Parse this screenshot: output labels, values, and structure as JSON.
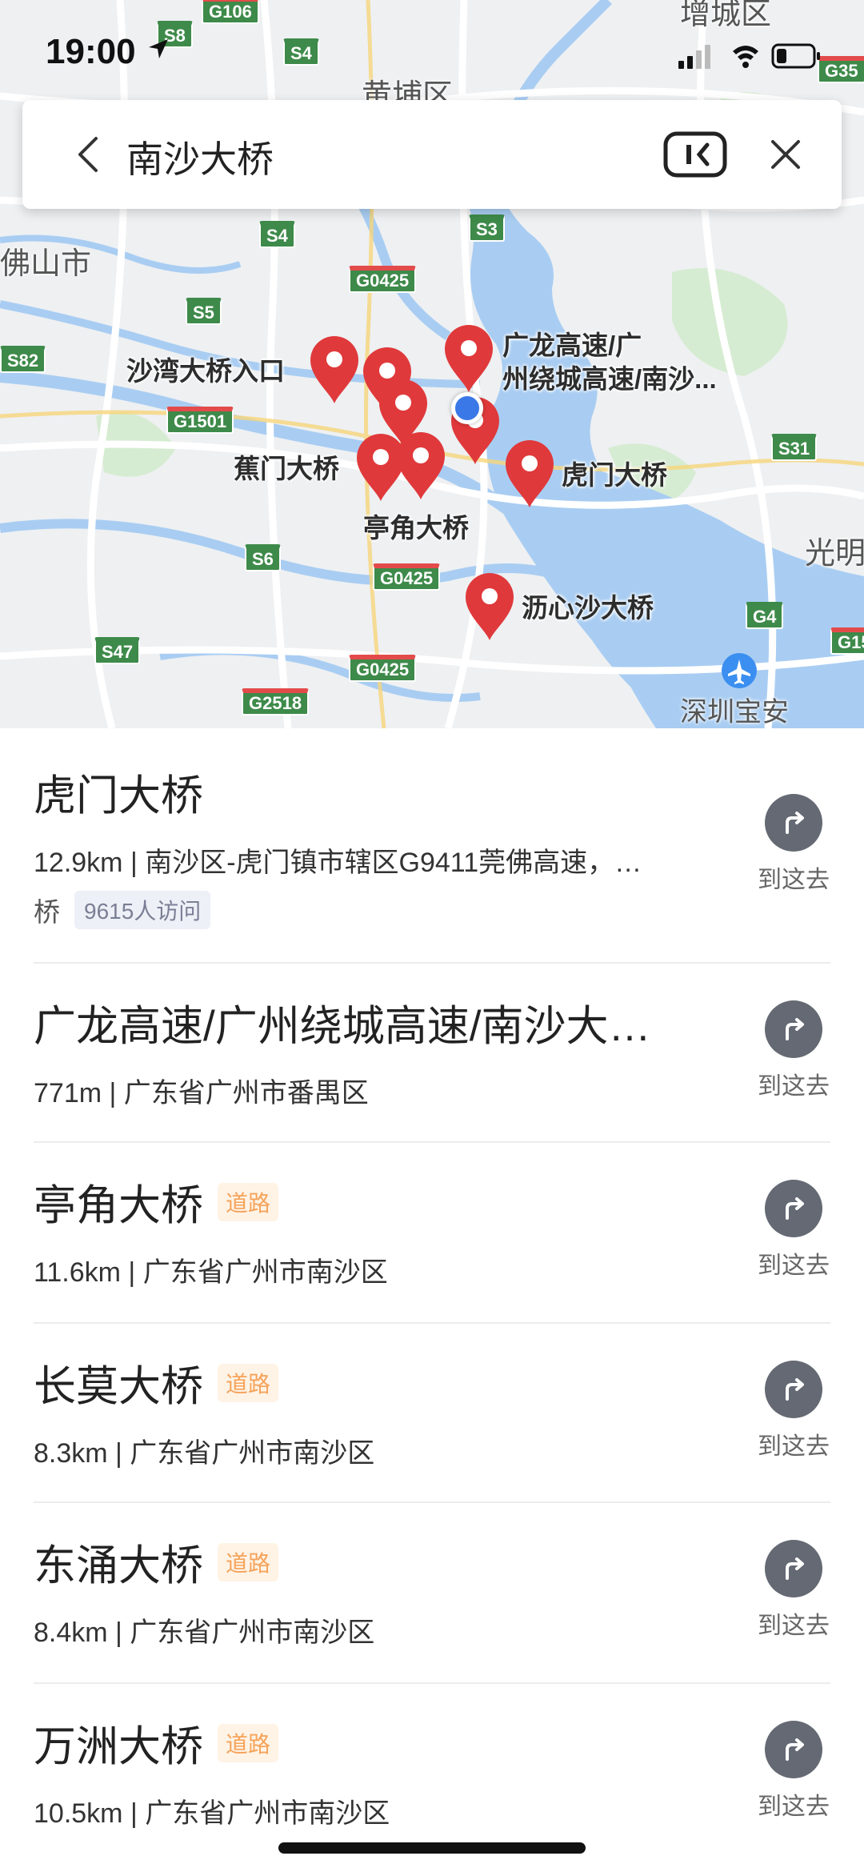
{
  "status": {
    "time": "19:00"
  },
  "search": {
    "query": "南沙大桥"
  },
  "map": {
    "labels": [
      "沙湾大桥入口",
      "广龙高速/广",
      "州绕城高速/南沙...",
      "蕉门大桥",
      "虎门大桥",
      "亭角大桥",
      "沥心沙大桥"
    ],
    "regions": [
      "佛山市",
      "黄埔区",
      "增城区",
      "光明",
      "深圳宝安"
    ],
    "shields": [
      "G106",
      "S8",
      "S4",
      "S4",
      "S3",
      "G0425",
      "S5",
      "S82",
      "G1501",
      "S31",
      "S6",
      "G0425",
      "G4",
      "S47",
      "G0425",
      "G2518",
      "G35",
      "G15"
    ]
  },
  "results": [
    {
      "title": "虎门大桥",
      "tag": "",
      "subtitle": "12.9km | 南沙区-虎门镇市辖区G9411莞佛高速，…",
      "extra": "桥",
      "visits": "9615人访问",
      "action": "到这去"
    },
    {
      "title": "广龙高速/广州绕城高速/南沙大…",
      "tag": "",
      "subtitle": "771m | 广东省广州市番禺区",
      "extra": "",
      "visits": "",
      "action": "到这去"
    },
    {
      "title": "亭角大桥",
      "tag": "道路",
      "subtitle": "11.6km | 广东省广州市南沙区",
      "extra": "",
      "visits": "",
      "action": "到这去"
    },
    {
      "title": "长莫大桥",
      "tag": "道路",
      "subtitle": "8.3km | 广东省广州市南沙区",
      "extra": "",
      "visits": "",
      "action": "到这去"
    },
    {
      "title": "东涌大桥",
      "tag": "道路",
      "subtitle": "8.4km | 广东省广州市南沙区",
      "extra": "",
      "visits": "",
      "action": "到这去"
    },
    {
      "title": "万洲大桥",
      "tag": "道路",
      "subtitle": "10.5km | 广东省广州市南沙区",
      "extra": "",
      "visits": "",
      "action": "到这去"
    }
  ],
  "colors": {
    "pin": "#e0393b",
    "water": "#a9cdf2",
    "route": "#646973",
    "tag": "#f5a35a"
  }
}
